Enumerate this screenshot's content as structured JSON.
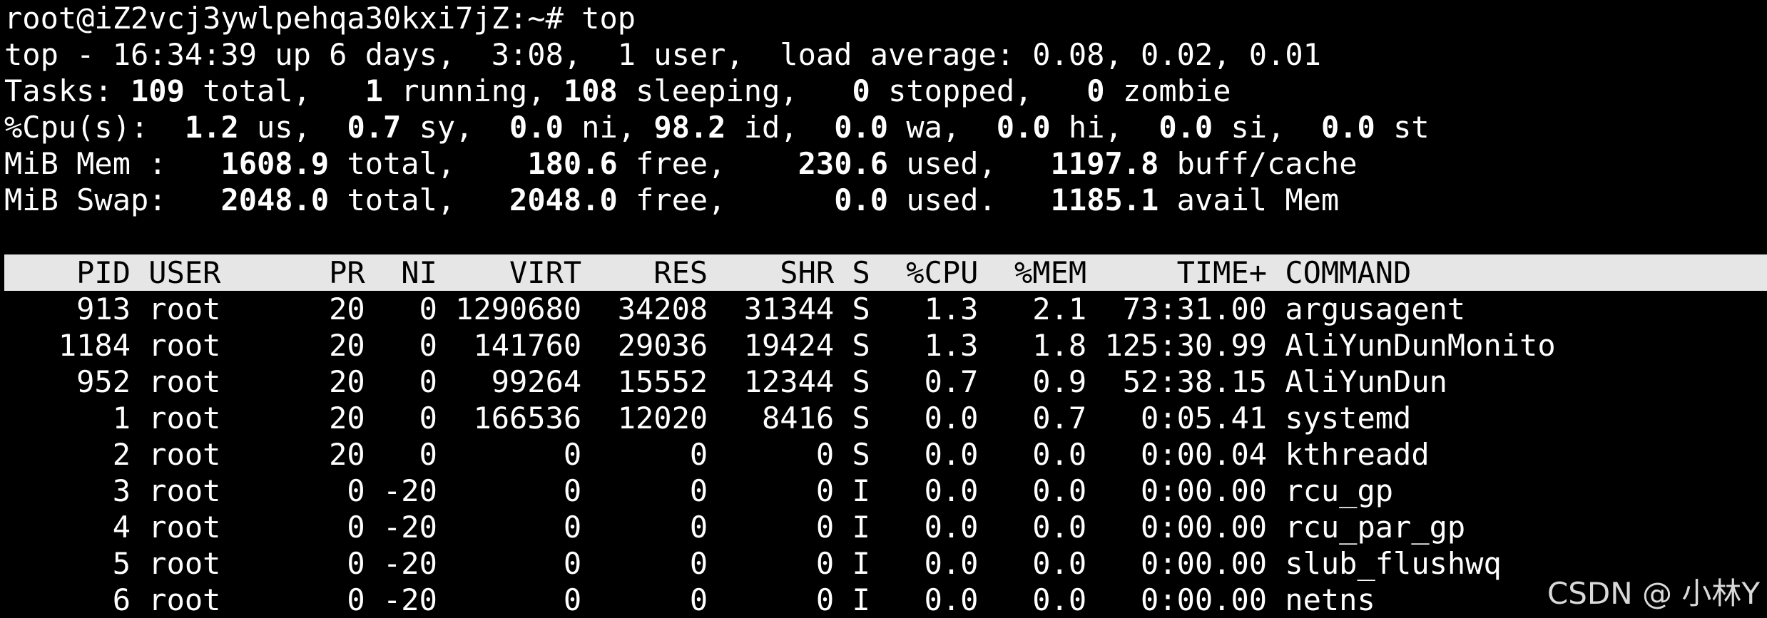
{
  "prompt": {
    "text": "root@iZ2vcj3ywlpehqa30kxi7jZ:~# top"
  },
  "summary": {
    "uptime": {
      "prefix": "top - 16:34:39 up 6 days,  3:08,  1 user,  load average: 0.08, 0.02, 0.01"
    },
    "tasks": {
      "label": "Tasks: ",
      "total": "109",
      "total_label": " total,   ",
      "running": "1",
      "running_label": " running, ",
      "sleeping": "108",
      "sleeping_label": " sleeping,   ",
      "stopped": "0",
      "stopped_label": " stopped,   ",
      "zombie": "0",
      "zombie_label": " zombie"
    },
    "cpu": {
      "label": "%Cpu(s):  ",
      "us": "1.2",
      "us_label": " us,  ",
      "sy": "0.7",
      "sy_label": " sy,  ",
      "ni": "0.0",
      "ni_label": " ni, ",
      "id": "98.2",
      "id_label": " id,  ",
      "wa": "0.0",
      "wa_label": " wa,  ",
      "hi": "0.0",
      "hi_label": " hi,  ",
      "si": "0.0",
      "si_label": " si,  ",
      "st": "0.0",
      "st_label": " st"
    },
    "mem": {
      "label": "MiB Mem :   ",
      "total": "1608.9",
      "total_label": " total,    ",
      "free": "180.6",
      "free_label": " free,    ",
      "used": "230.6",
      "used_label": " used,   ",
      "buff": "1197.8",
      "buff_label": " buff/cache"
    },
    "swap": {
      "label": "MiB Swap:   ",
      "total": "2048.0",
      "total_label": " total,   ",
      "free": "2048.0",
      "free_label": " free,      ",
      "used": "0.0",
      "used_label": " used.   ",
      "avail": "1185.1",
      "avail_label": " avail Mem"
    }
  },
  "table": {
    "header": "    PID USER      PR  NI    VIRT    RES    SHR S  %CPU  %MEM     TIME+ COMMAND",
    "rows": [
      "    913 root      20   0 1290680  34208  31344 S   1.3   2.1  73:31.00 argusagent",
      "   1184 root      20   0  141760  29036  19424 S   1.3   1.8 125:30.99 AliYunDunMonito",
      "    952 root      20   0   99264  15552  12344 S   0.7   0.9  52:38.15 AliYunDun",
      "      1 root      20   0  166536  12020   8416 S   0.0   0.7   0:05.41 systemd",
      "      2 root      20   0       0      0      0 S   0.0   0.0   0:00.04 kthreadd",
      "      3 root       0 -20       0      0      0 I   0.0   0.0   0:00.00 rcu_gp",
      "      4 root       0 -20       0      0      0 I   0.0   0.0   0:00.00 rcu_par_gp",
      "      5 root       0 -20       0      0      0 I   0.0   0.0   0:00.00 slub_flushwq",
      "      6 root       0 -20       0      0      0 I   0.0   0.0   0:00.00 netns"
    ]
  },
  "watermark": {
    "text": "CSDN @ 小林Y"
  }
}
